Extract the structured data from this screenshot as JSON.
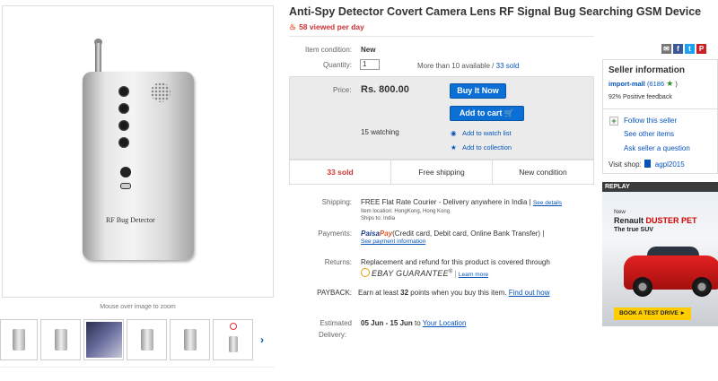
{
  "gallery": {
    "device_label": "RF Bug Detector",
    "mouse_hint": "Mouse over image to zoom",
    "thumb_count": 6
  },
  "product": {
    "title": "Anti-Spy Detector Covert Camera Lens RF Signal Bug Searching GSM Device",
    "viewed": "58 viewed per day"
  },
  "item": {
    "condition_label": "Item condition:",
    "condition_value": "New",
    "quantity_label": "Quantity:",
    "quantity_value": "1",
    "availability": "More than 10 available /",
    "sold_link": "33 sold"
  },
  "price": {
    "label": "Price:",
    "value": "Rs. 800.00",
    "buy_now": "Buy It Now",
    "add_to_cart": "Add to cart",
    "watching": "15 watching",
    "add_watch": "Add to watch list",
    "add_collection": "Add to collection"
  },
  "stats": {
    "sold": "33 sold",
    "shipping": "Free shipping",
    "condition": "New condition"
  },
  "shipping": {
    "label": "Shipping:",
    "value": "FREE  Flat Rate Courier - Delivery anywhere in India |",
    "see_details": "See details",
    "location": "Item location: HongKong, Hong Kong",
    "ships_to": "Ships to: India"
  },
  "payments": {
    "label": "Payments:",
    "brand_a": "Paisa",
    "brand_b": "Pay",
    "methods": "(Credit card, Debit card, Online Bank Transfer)  |",
    "see_info": "See payment information"
  },
  "returns": {
    "label": "Returns:",
    "text": "Replacement and refund for this product is covered through",
    "guarantee": "EBAY GUARANTEE",
    "learn_more": "Learn more"
  },
  "payback": {
    "label": "PAYBACK:",
    "text_a": "Earn at least",
    "points": "32",
    "text_b": "points when you buy this item.",
    "find_out": "Find out how"
  },
  "delivery": {
    "label_a": "Estimated",
    "label_b": "Delivery:",
    "range": "05 Jun - 15 Jun",
    "to": "to",
    "location_link": "Your Location"
  },
  "social": [
    "email-icon",
    "facebook-icon",
    "twitter-icon",
    "pinterest-icon"
  ],
  "seller": {
    "title": "Seller information",
    "name": "import-mall",
    "score": "(6186",
    "close": ")",
    "feedback": "92% Positive feedback",
    "follow": "Follow this seller",
    "other_items": "See other items",
    "ask": "Ask seller a question",
    "visit_label": "Visit shop:",
    "shop_name": "agpl2015"
  },
  "ad": {
    "replay": "REPLAY",
    "new": "New",
    "brand_a": "Renault",
    "brand_b": "DUSTER PET",
    "tagline": "The true SUV",
    "cta": "BOOK A TEST DRIVE ►"
  },
  "colors": {
    "link": "#0654ba",
    "button": "#0b6fd6",
    "sold_red": "#cc3333"
  }
}
